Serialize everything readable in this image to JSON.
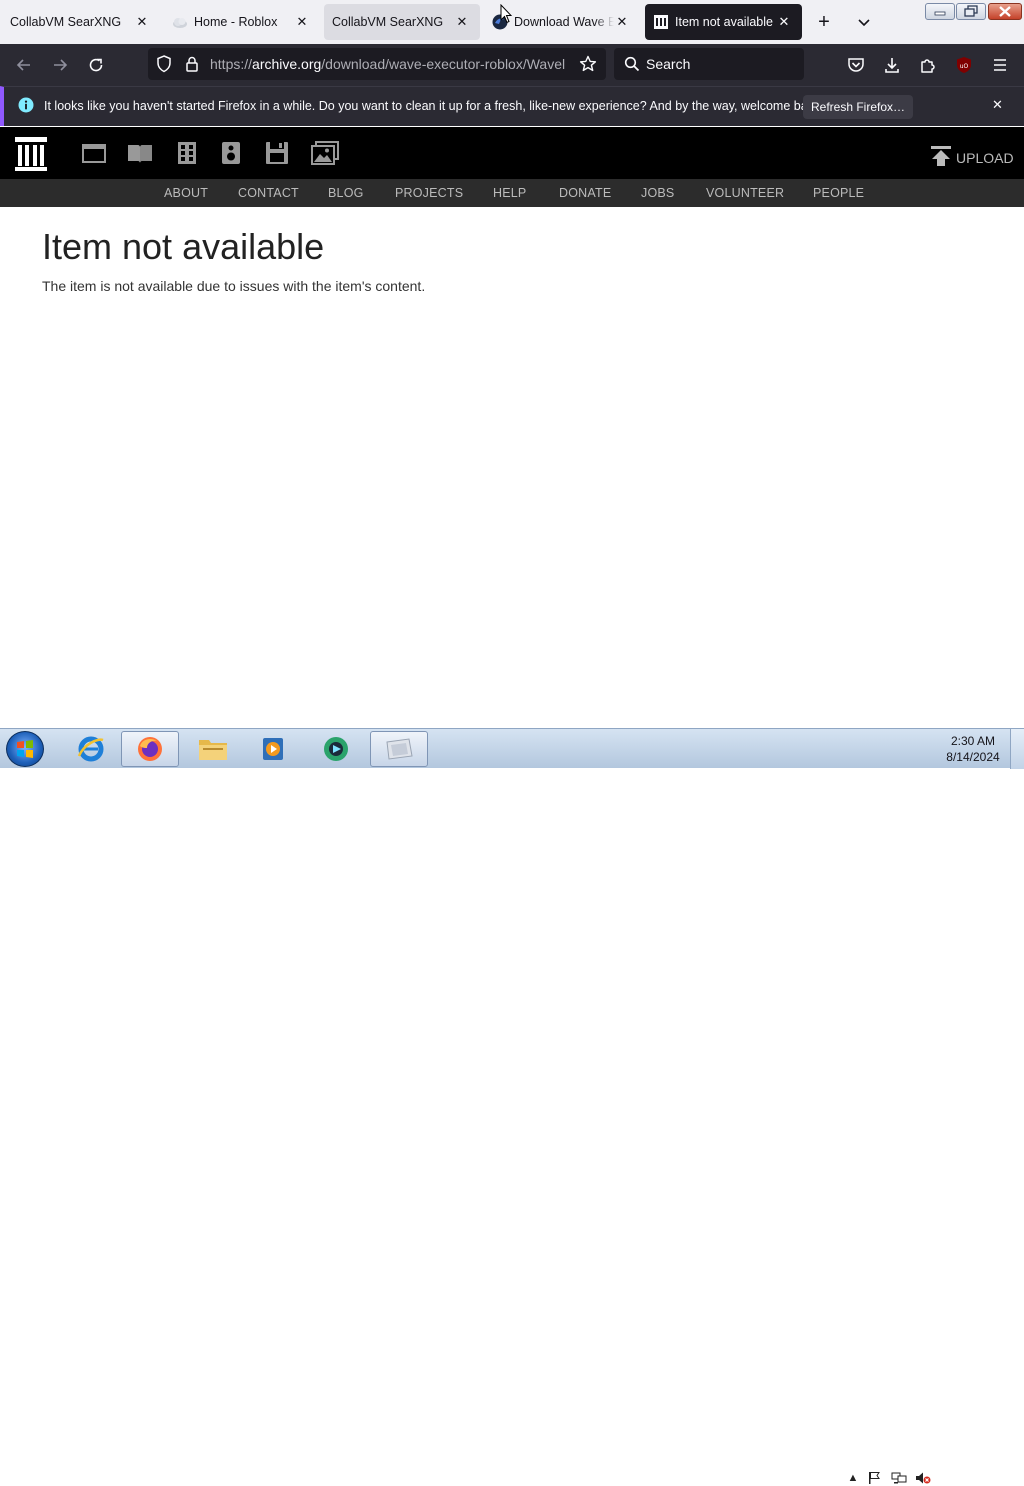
{
  "tabs": [
    {
      "title": "CollabVM SearXNG",
      "favicon": "none",
      "state": "inactive"
    },
    {
      "title": "Home - Roblox",
      "favicon": "cloud-icon",
      "state": "inactive"
    },
    {
      "title": "CollabVM SearXNG",
      "favicon": "none",
      "state": "hover"
    },
    {
      "title": "Download Wave Ex",
      "favicon": "wave-icon",
      "state": "inactive"
    },
    {
      "title": "Item not available",
      "favicon": "archive-icon",
      "state": "active"
    }
  ],
  "tab_close_glyph": "✕",
  "new_tab_glyph": "+",
  "list_tabs_glyph": "⌄",
  "url": {
    "prefix": "https://",
    "host": "archive.org",
    "path": "/download/wave-executor-roblox/Wavel"
  },
  "search": {
    "placeholder": "Search"
  },
  "notification": {
    "text": "It looks like you haven't started Firefox in a while. Do you want to clean it up for a fresh, like-new experience? And by the way, welcome back!",
    "button": "Refresh Firefox…",
    "close_glyph": "✕"
  },
  "archive": {
    "upload_label": "UPLOAD",
    "nav": [
      "ABOUT",
      "CONTACT",
      "BLOG",
      "PROJECTS",
      "HELP",
      "DONATE",
      "JOBS",
      "VOLUNTEER",
      "PEOPLE"
    ]
  },
  "page": {
    "title": "Item not available",
    "message": "The item is not available due to issues with the item's content."
  },
  "taskbar": {
    "time": "2:30 AM",
    "date": "8/14/2024",
    "apps": [
      "internet-explorer-icon",
      "firefox-icon",
      "file-explorer-icon",
      "media-player-icon",
      "app-icon",
      "window-thumbnail-icon"
    ]
  },
  "colors": {
    "accent_purple": "#9059ff",
    "firefox_dark": "#2b2a33",
    "archive_black": "#000000"
  }
}
